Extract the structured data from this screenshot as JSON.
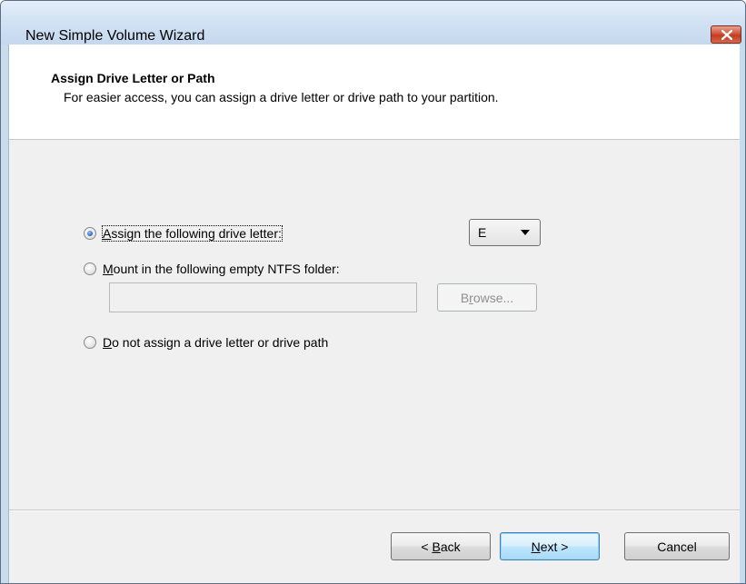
{
  "window": {
    "title": "New Simple Volume Wizard",
    "close_glyph": "✕"
  },
  "header": {
    "title": "Assign Drive Letter or Path",
    "subtitle": "For easier access, you can assign a drive letter or drive path to your partition."
  },
  "options": {
    "assign_letter": {
      "label_mnemonic": "A",
      "label_rest": "ssign the following drive letter:",
      "checked": true
    },
    "mount_folder": {
      "label_mnemonic": "M",
      "label_rest": "ount in the following empty NTFS folder:",
      "checked": false
    },
    "no_assign": {
      "label_mnemonic": "D",
      "label_rest": "o not assign a drive letter or drive path",
      "checked": false
    }
  },
  "drive_letter": {
    "selected": "E"
  },
  "folder_path": {
    "value": ""
  },
  "browse_button": {
    "label_pre": "B",
    "label_mnemonic": "r",
    "label_rest": "owse..."
  },
  "footer": {
    "back_prefix": "< ",
    "back_mnemonic": "B",
    "back_rest": "ack",
    "next_mnemonic": "N",
    "next_rest": "ext >",
    "cancel_label": "Cancel"
  }
}
